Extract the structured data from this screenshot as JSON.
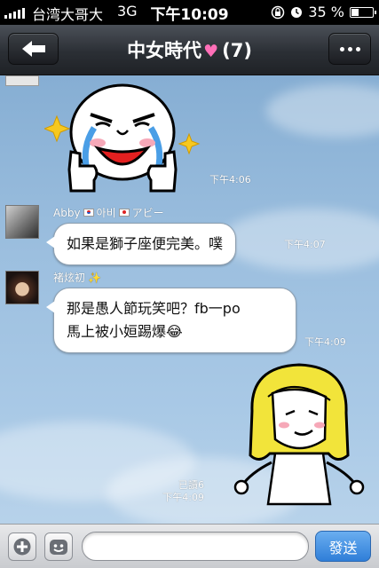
{
  "status_bar": {
    "carrier": "台湾大哥大",
    "network": "3G",
    "time": "下午10:09",
    "battery_text": "35 %",
    "battery_level": 0.35
  },
  "header": {
    "title": "中女時代",
    "member_count": "(7)"
  },
  "messages": [
    {
      "type": "sticker",
      "sticker": "crying-moon-thumbs-up",
      "time": "下午4:06"
    },
    {
      "type": "text",
      "sender": "Abby",
      "sender_extra_ko": "아비",
      "sender_extra_ja": "アビー",
      "text": "如果是獅子座便完美。噗",
      "time": "下午4:07"
    },
    {
      "type": "text",
      "sender": "褚炫初",
      "sender_extra": "✨",
      "lines": [
        "那是愚人節玩笑吧？fb一po",
        "馬上被小姮踢爆😂"
      ],
      "time": "下午4:09"
    },
    {
      "type": "sticker",
      "sticker": "blonde-cony-dancing",
      "read": "已讀6",
      "time": "下午4:09"
    }
  ],
  "input": {
    "placeholder": "",
    "send_label": "發送"
  },
  "icons": [
    "back-arrow-icon",
    "more-icon",
    "plus-icon",
    "emoticon-icon"
  ],
  "colors": {
    "chat_bg": "#9cbfdf",
    "header_bg": "#2b2f35",
    "send_button": "#3b8be0"
  }
}
